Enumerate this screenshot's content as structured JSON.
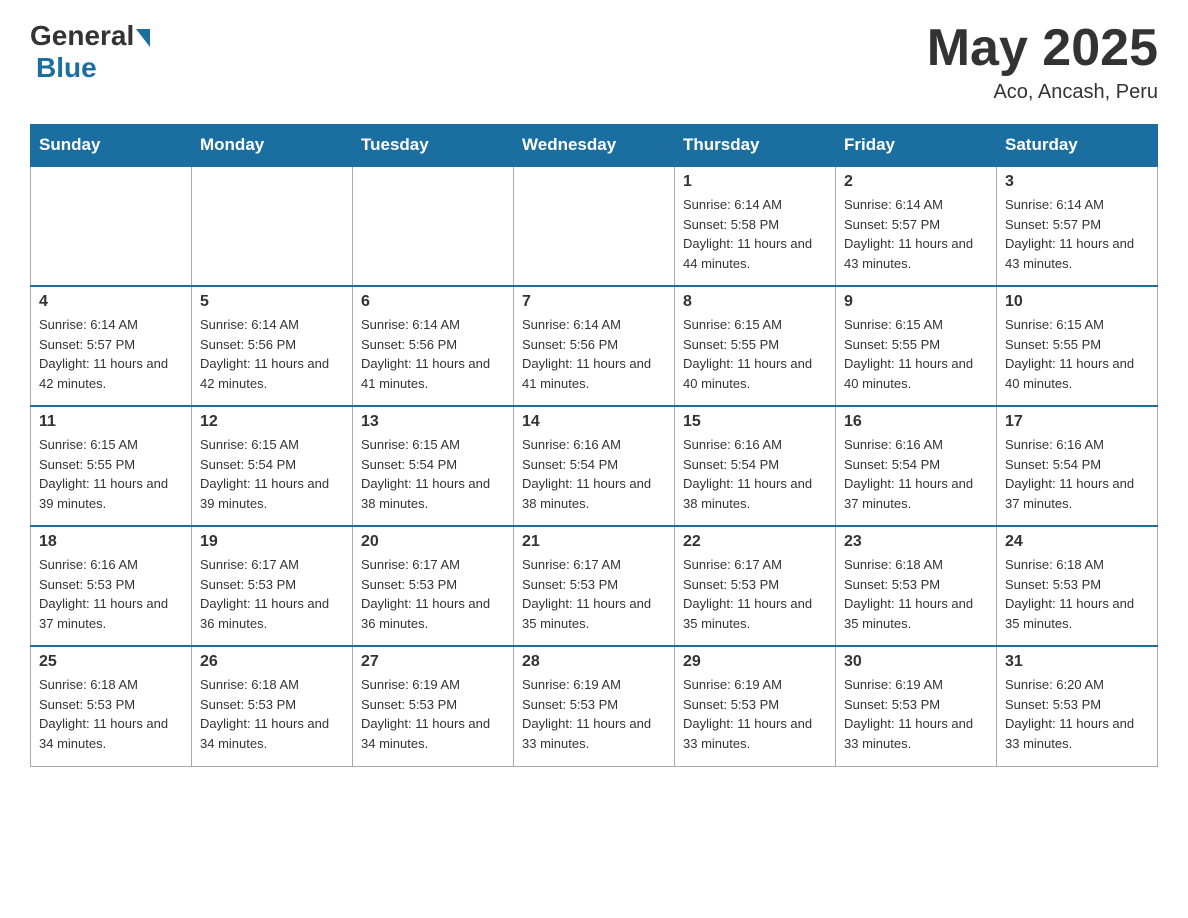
{
  "header": {
    "logo": {
      "general": "General",
      "blue": "Blue",
      "subtitle": "Blue"
    },
    "title": "May 2025",
    "location": "Aco, Ancash, Peru"
  },
  "calendar": {
    "days_of_week": [
      "Sunday",
      "Monday",
      "Tuesday",
      "Wednesday",
      "Thursday",
      "Friday",
      "Saturday"
    ],
    "weeks": [
      [
        {
          "day": "",
          "info": ""
        },
        {
          "day": "",
          "info": ""
        },
        {
          "day": "",
          "info": ""
        },
        {
          "day": "",
          "info": ""
        },
        {
          "day": "1",
          "info": "Sunrise: 6:14 AM\nSunset: 5:58 PM\nDaylight: 11 hours and 44 minutes."
        },
        {
          "day": "2",
          "info": "Sunrise: 6:14 AM\nSunset: 5:57 PM\nDaylight: 11 hours and 43 minutes."
        },
        {
          "day": "3",
          "info": "Sunrise: 6:14 AM\nSunset: 5:57 PM\nDaylight: 11 hours and 43 minutes."
        }
      ],
      [
        {
          "day": "4",
          "info": "Sunrise: 6:14 AM\nSunset: 5:57 PM\nDaylight: 11 hours and 42 minutes."
        },
        {
          "day": "5",
          "info": "Sunrise: 6:14 AM\nSunset: 5:56 PM\nDaylight: 11 hours and 42 minutes."
        },
        {
          "day": "6",
          "info": "Sunrise: 6:14 AM\nSunset: 5:56 PM\nDaylight: 11 hours and 41 minutes."
        },
        {
          "day": "7",
          "info": "Sunrise: 6:14 AM\nSunset: 5:56 PM\nDaylight: 11 hours and 41 minutes."
        },
        {
          "day": "8",
          "info": "Sunrise: 6:15 AM\nSunset: 5:55 PM\nDaylight: 11 hours and 40 minutes."
        },
        {
          "day": "9",
          "info": "Sunrise: 6:15 AM\nSunset: 5:55 PM\nDaylight: 11 hours and 40 minutes."
        },
        {
          "day": "10",
          "info": "Sunrise: 6:15 AM\nSunset: 5:55 PM\nDaylight: 11 hours and 40 minutes."
        }
      ],
      [
        {
          "day": "11",
          "info": "Sunrise: 6:15 AM\nSunset: 5:55 PM\nDaylight: 11 hours and 39 minutes."
        },
        {
          "day": "12",
          "info": "Sunrise: 6:15 AM\nSunset: 5:54 PM\nDaylight: 11 hours and 39 minutes."
        },
        {
          "day": "13",
          "info": "Sunrise: 6:15 AM\nSunset: 5:54 PM\nDaylight: 11 hours and 38 minutes."
        },
        {
          "day": "14",
          "info": "Sunrise: 6:16 AM\nSunset: 5:54 PM\nDaylight: 11 hours and 38 minutes."
        },
        {
          "day": "15",
          "info": "Sunrise: 6:16 AM\nSunset: 5:54 PM\nDaylight: 11 hours and 38 minutes."
        },
        {
          "day": "16",
          "info": "Sunrise: 6:16 AM\nSunset: 5:54 PM\nDaylight: 11 hours and 37 minutes."
        },
        {
          "day": "17",
          "info": "Sunrise: 6:16 AM\nSunset: 5:54 PM\nDaylight: 11 hours and 37 minutes."
        }
      ],
      [
        {
          "day": "18",
          "info": "Sunrise: 6:16 AM\nSunset: 5:53 PM\nDaylight: 11 hours and 37 minutes."
        },
        {
          "day": "19",
          "info": "Sunrise: 6:17 AM\nSunset: 5:53 PM\nDaylight: 11 hours and 36 minutes."
        },
        {
          "day": "20",
          "info": "Sunrise: 6:17 AM\nSunset: 5:53 PM\nDaylight: 11 hours and 36 minutes."
        },
        {
          "day": "21",
          "info": "Sunrise: 6:17 AM\nSunset: 5:53 PM\nDaylight: 11 hours and 35 minutes."
        },
        {
          "day": "22",
          "info": "Sunrise: 6:17 AM\nSunset: 5:53 PM\nDaylight: 11 hours and 35 minutes."
        },
        {
          "day": "23",
          "info": "Sunrise: 6:18 AM\nSunset: 5:53 PM\nDaylight: 11 hours and 35 minutes."
        },
        {
          "day": "24",
          "info": "Sunrise: 6:18 AM\nSunset: 5:53 PM\nDaylight: 11 hours and 35 minutes."
        }
      ],
      [
        {
          "day": "25",
          "info": "Sunrise: 6:18 AM\nSunset: 5:53 PM\nDaylight: 11 hours and 34 minutes."
        },
        {
          "day": "26",
          "info": "Sunrise: 6:18 AM\nSunset: 5:53 PM\nDaylight: 11 hours and 34 minutes."
        },
        {
          "day": "27",
          "info": "Sunrise: 6:19 AM\nSunset: 5:53 PM\nDaylight: 11 hours and 34 minutes."
        },
        {
          "day": "28",
          "info": "Sunrise: 6:19 AM\nSunset: 5:53 PM\nDaylight: 11 hours and 33 minutes."
        },
        {
          "day": "29",
          "info": "Sunrise: 6:19 AM\nSunset: 5:53 PM\nDaylight: 11 hours and 33 minutes."
        },
        {
          "day": "30",
          "info": "Sunrise: 6:19 AM\nSunset: 5:53 PM\nDaylight: 11 hours and 33 minutes."
        },
        {
          "day": "31",
          "info": "Sunrise: 6:20 AM\nSunset: 5:53 PM\nDaylight: 11 hours and 33 minutes."
        }
      ]
    ]
  }
}
